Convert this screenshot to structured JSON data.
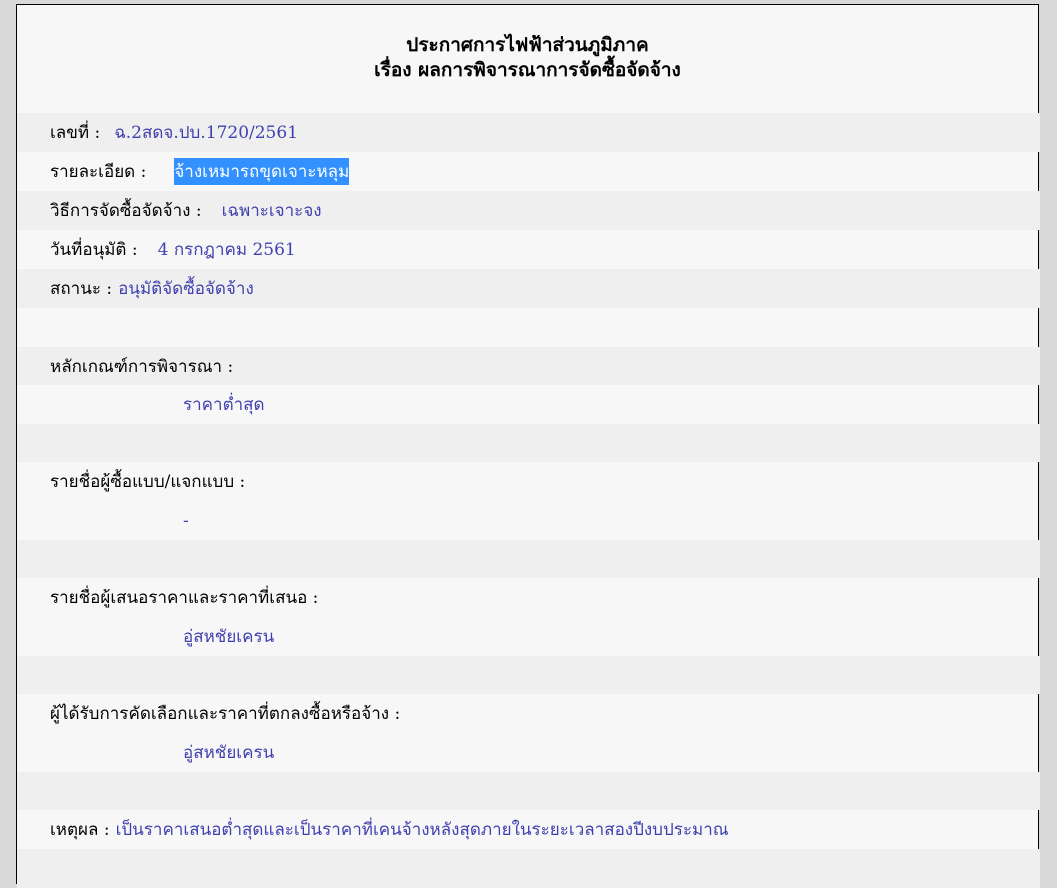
{
  "announcement": {
    "title_line1": "ประกาศการไฟฟ้าส่วนภูมิภาค",
    "title_line2": "เรื่อง ผลการพิจารณาการจัดซื้อจัดจ้าง"
  },
  "fields": {
    "number_label": "เลขที่ :",
    "number_value": "ฉ.2สดจ.ปบ.1720/2561",
    "detail_label": "รายละเอียด :",
    "detail_value": "จ้างเหมารถขุดเจาะหลุม",
    "method_label": "วิธีการจัดซื้อจัดจ้าง :",
    "method_value": "เฉพาะเจาะจง",
    "approval_date_label": "วันที่อนุมัติ :",
    "approval_date_value": "4 กรกฎาคม 2561",
    "status_label": "สถานะ :",
    "status_value": "อนุมัติจัดซื้อจัดจ้าง",
    "criteria_label": "หลักเกณฑ์การพิจารณา :",
    "criteria_value": "ราคาต่ำสุด",
    "buyers_label": "รายชื่อผู้ซื้อแบบ/แจกแบบ :",
    "buyers_value": "-",
    "bidders_label": "รายชื่อผู้เสนอราคาและราคาที่เสนอ :",
    "bidders_value": "อู่สหชัยเครน",
    "winner_label": "ผู้ได้รับการคัดเลือกและราคาที่ตกลงซื้อหรือจ้าง :",
    "winner_value": "อู่สหชัยเครน",
    "reason_label": "เหตุผล :",
    "reason_value": "เป็นราคาเสนอต่ำสุดและเป็นราคาที่เคนจ้างหลังสุดภายในระยะเวลาสองปีงบประมาณ"
  },
  "colors": {
    "value_text": "#4040b0",
    "selection_bg": "#3390ff",
    "row_alt_bg": "#efefef",
    "page_bg": "#f7f7f7"
  }
}
